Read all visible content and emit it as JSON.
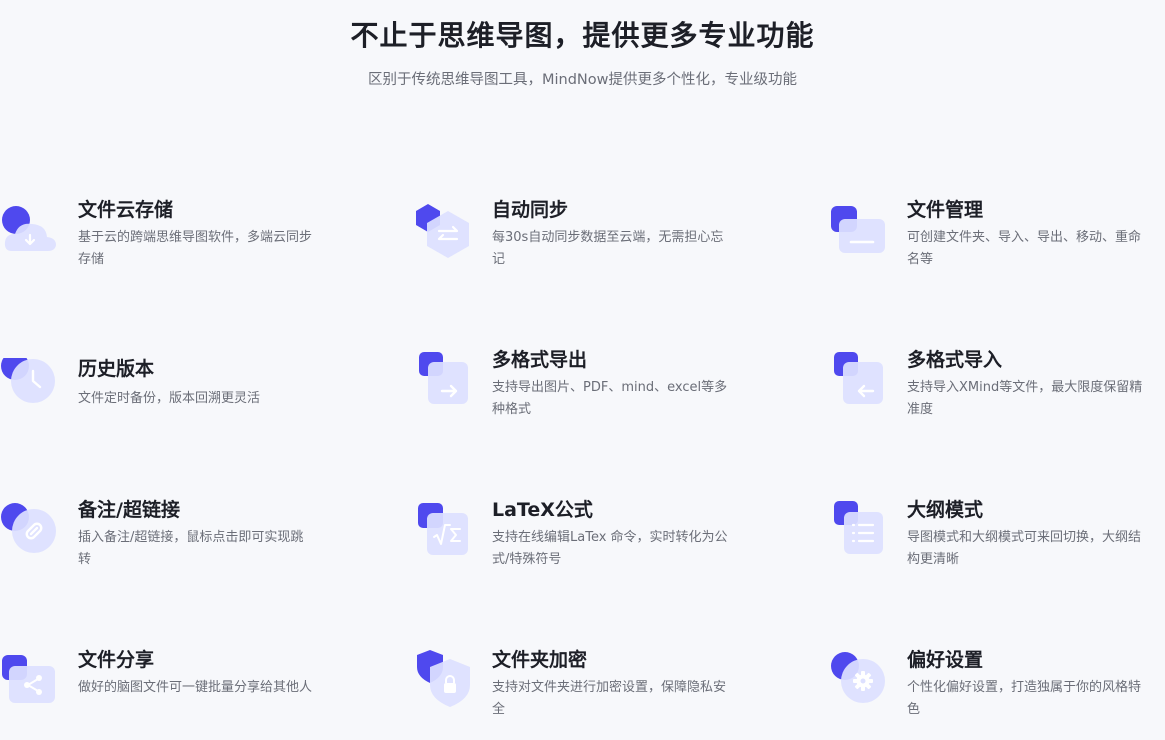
{
  "header": {
    "title": "不止于思维导图，提供更多专业功能",
    "subtitle": "区别于传统思维导图工具，MindNow提供更多个性化，专业级功能"
  },
  "colors": {
    "accent": "#4f49ee",
    "icon_front": "#dde0ff",
    "icon_glyph": "#ffffff"
  },
  "features": [
    {
      "icon": "cloud-download-icon",
      "name": "文件云存储",
      "desc": "基于云的跨端思维导图软件，多端云同步存储"
    },
    {
      "icon": "sync-arrows-icon",
      "name": "自动同步",
      "desc": "每30s自动同步数据至云端，无需担心忘记"
    },
    {
      "icon": "folder-manage-icon",
      "name": "文件管理",
      "desc": "可创建文件夹、导入、导出、移动、重命名等"
    },
    {
      "icon": "clock-history-icon",
      "name": "历史版本",
      "desc": "文件定时备份，版本回溯更灵活"
    },
    {
      "icon": "export-arrow-icon",
      "name": "多格式导出",
      "desc": "支持导出图片、PDF、mind、excel等多种格式"
    },
    {
      "icon": "import-arrow-icon",
      "name": "多格式导入",
      "desc": "支持导入XMind等文件，最大限度保留精准度"
    },
    {
      "icon": "link-icon",
      "name": "备注/超链接",
      "desc": "插入备注/超链接，鼠标点击即可实现跳转"
    },
    {
      "icon": "formula-icon",
      "name": "LaTeX公式",
      "desc": "支持在线编辑LaTex 命令，实时转化为公式/特殊符号"
    },
    {
      "icon": "outline-list-icon",
      "name": "大纲模式",
      "desc": "导图模式和大纲模式可来回切换，大纲结构更清晰"
    },
    {
      "icon": "share-icon",
      "name": "文件分享",
      "desc": "做好的脑图文件可一键批量分享给其他人"
    },
    {
      "icon": "shield-lock-icon",
      "name": "文件夹加密",
      "desc": "支持对文件夹进行加密设置，保障隐私安全"
    },
    {
      "icon": "gear-icon",
      "name": "偏好设置",
      "desc": "个性化偏好设置，打造独属于你的风格特色"
    }
  ]
}
